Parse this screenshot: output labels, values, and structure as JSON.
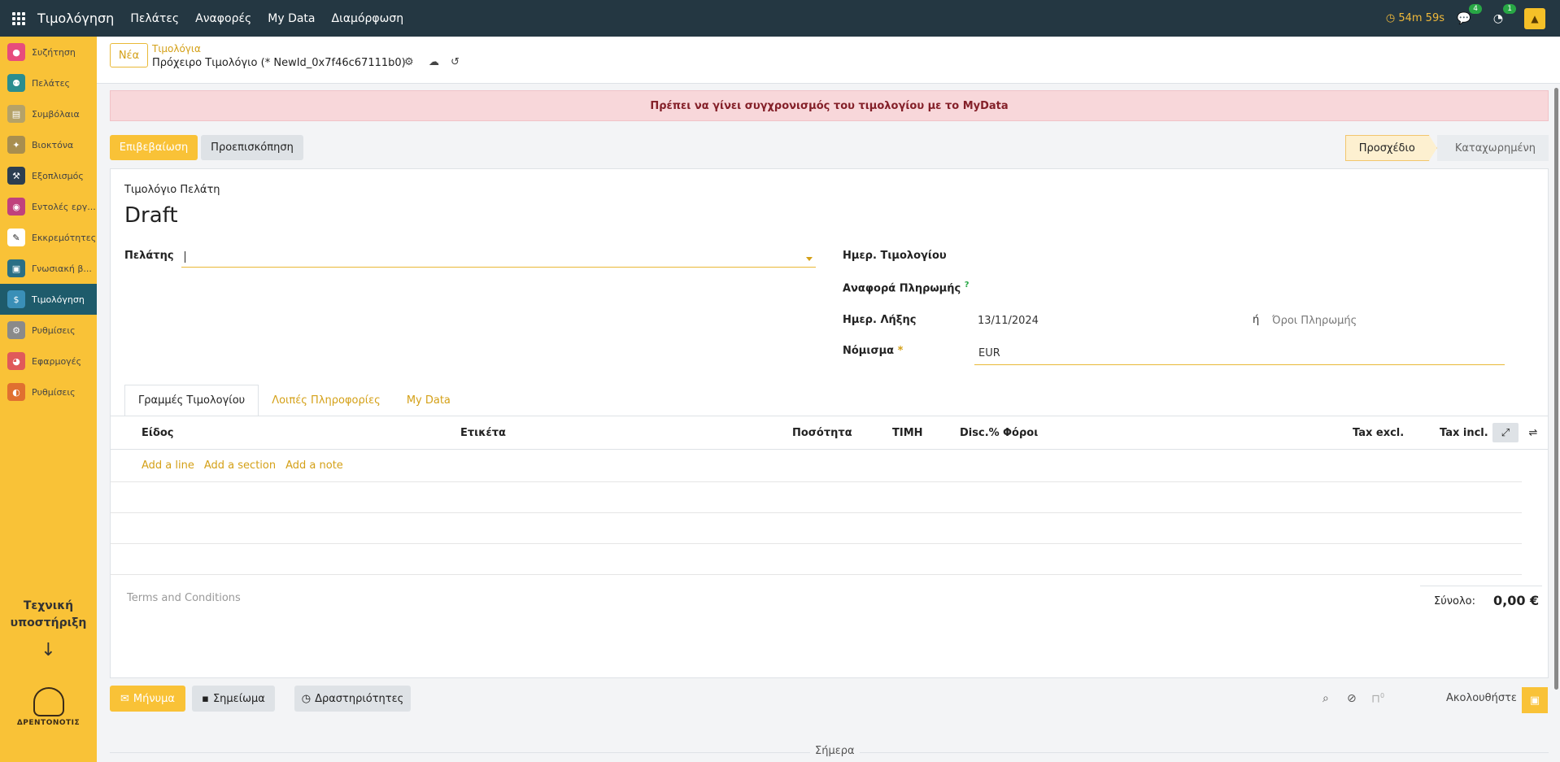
{
  "topbar": {
    "app_title": "Τιμολόγηση",
    "menu": [
      "Πελάτες",
      "Αναφορές",
      "My Data",
      "Διαμόρφωση"
    ],
    "timer": "54m 59s",
    "messages_badge": "4",
    "activities_badge": "1"
  },
  "sidebar": {
    "items": [
      {
        "label": "Συζήτηση",
        "icon": "chat-bubble-icon",
        "color": "#e74c7c"
      },
      {
        "label": "Πελάτες",
        "icon": "users-icon",
        "color": "#2a8d8f"
      },
      {
        "label": "Συμβόλαια",
        "icon": "contract-icon",
        "color": "#b5a268"
      },
      {
        "label": "Βιοκτόνα",
        "icon": "biocide-icon",
        "color": "#a88e4f"
      },
      {
        "label": "Εξοπλισμός",
        "icon": "hammer-icon",
        "color": "#2c3e50"
      },
      {
        "label": "Εντολές εργ...",
        "icon": "work-order-icon",
        "color": "#c0417d"
      },
      {
        "label": "Εκκρεμότητες",
        "icon": "pencil-icon",
        "color": "#ffffff"
      },
      {
        "label": "Γνωσιακή β...",
        "icon": "book-icon",
        "color": "#2a6f85"
      },
      {
        "label": "Τιμολόγηση",
        "icon": "invoice-icon",
        "color": "#3a8fb7"
      },
      {
        "label": "Ρυθμίσεις",
        "icon": "gear-icon",
        "color": "#8a8a8a"
      },
      {
        "label": "Εφαρμογές",
        "icon": "apps-pie-icon",
        "color": "#e05a5a"
      },
      {
        "label": "Ρυθμίσεις",
        "icon": "settings-arc-icon",
        "color": "#e07030"
      }
    ],
    "active_index": 8,
    "support_text": "Τεχνική υποστήριξη",
    "logo_text": "ΔΡΕΝΤΟΝΟΤΙΣ"
  },
  "control": {
    "new_button": "Νέα",
    "breadcrumb_parent": "Τιμολόγια",
    "breadcrumb_current": "Πρόχειρο Τιμολόγιο (* NewId_0x7f46c67111b0)"
  },
  "alert": "Πρέπει να γίνει συγχρονισμός του τιμολογίου με το MyData",
  "actions": {
    "confirm": "Επιβεβαίωση",
    "preview": "Προεπισκόπηση"
  },
  "status": {
    "steps": [
      "Προσχέδιο",
      "Καταχωρημένη"
    ],
    "current": "Προσχέδιο"
  },
  "form": {
    "doc_type": "Τιμολόγιο Πελάτη",
    "doc_name": "Draft",
    "customer_label": "Πελάτης",
    "customer_value": "",
    "invoice_date_label": "Ημερ. Τιμολογίου",
    "invoice_date_value": "",
    "payment_ref_label": "Αναφορά Πληρωμής",
    "payment_ref_help": "?",
    "due_date_label": "Ημερ. Λήξης",
    "due_date_value": "13/11/2024",
    "or_text": "ή",
    "payment_terms_placeholder": "Όροι Πληρωμής",
    "currency_label": "Νόμισμα",
    "currency_required": "*",
    "currency_value": "EUR"
  },
  "tabs": [
    "Γραμμές Τιμολογίου",
    "Λοιπές Πληροφορίες",
    "My Data"
  ],
  "table": {
    "columns": [
      "Είδος",
      "Ετικέτα",
      "Ποσότητα",
      "ΤΙΜΗ",
      "Disc.%",
      "Φόροι",
      "Tax excl.",
      "Tax incl."
    ],
    "add_links": [
      "Add a line",
      "Add a section",
      "Add a note"
    ]
  },
  "footer": {
    "terms_placeholder": "Terms and Conditions",
    "total_label": "Σύνολο:",
    "total_value": "0,00 €"
  },
  "chatter": {
    "message_button": "Μήνυμα",
    "note_button": "Σημείωμα",
    "activities_button": "Δραστηριότητες",
    "followers_count": "0",
    "follow_label": "Ακολουθήστε",
    "today_label": "Σήμερα"
  },
  "colors": {
    "accent": "#f9c237",
    "topbar": "#243742",
    "active_sidebar": "#1e5b6b",
    "alert_bg": "#f8d7da",
    "alert_text": "#842029"
  }
}
